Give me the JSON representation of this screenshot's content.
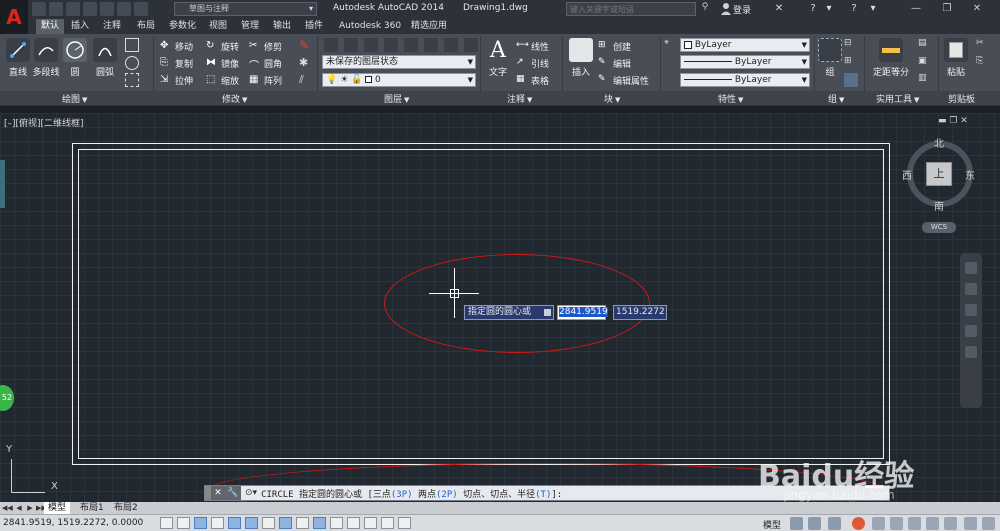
{
  "titlebar": {
    "workspace": "草图与注释",
    "app_title": "Autodesk AutoCAD 2014",
    "doc_title": "Drawing1.dwg",
    "search_placeholder": "键入关键字或短语",
    "login": "登录",
    "app_letter": "A"
  },
  "ribbon_tabs": [
    "默认",
    "插入",
    "注释",
    "布局",
    "参数化",
    "视图",
    "管理",
    "输出",
    "插件",
    "Autodesk 360",
    "精选应用"
  ],
  "active_tab": "默认",
  "ribbon": {
    "draw": {
      "title": "绘图",
      "line": "直线",
      "polyline": "多段线",
      "circle": "圆",
      "arc": "圆弧"
    },
    "modify": {
      "title": "修改",
      "move": "移动",
      "rotate": "旋转",
      "trim": "修剪",
      "copy": "复制",
      "mirror": "镜像",
      "fillet": "圆角",
      "stretch": "拉伸",
      "scale": "缩放",
      "array": "阵列"
    },
    "layers": {
      "title": "图层",
      "state": "未保存的图层状态",
      "current": "0"
    },
    "annotation": {
      "title": "注释",
      "text": "文字",
      "linear": "线性",
      "leader": "引线",
      "table": "表格"
    },
    "block": {
      "title": "块",
      "insert": "插入",
      "create": "创建",
      "edit": "编辑",
      "edit_attr": "编辑属性"
    },
    "properties": {
      "title": "特性",
      "color": "ByLayer",
      "linetype": "ByLayer",
      "lineweight": "ByLayer"
    },
    "groups": {
      "title": "组",
      "group": "组"
    },
    "utilities": {
      "title": "实用工具",
      "measure": "定距等分"
    },
    "clipboard": {
      "title": "剪贴板",
      "paste": "粘贴"
    }
  },
  "viewport": {
    "label": "[–][俯视][二维线框]",
    "prompt": "指定圆的圆心或",
    "coord_x": "2841.9519",
    "coord_y": "1519.2272"
  },
  "viewcube": {
    "north": "北",
    "south": "南",
    "east": "东",
    "west": "西",
    "face": "上",
    "wcs": "WCS"
  },
  "ucs": {
    "x": "X",
    "y": "Y"
  },
  "badge": "52",
  "command": {
    "name": "CIRCLE",
    "prompt": "指定圆的圆心或",
    "open": "[",
    "opt1_label": "三点",
    "opt1_key": "(3P)",
    "opt2_label": "两点",
    "opt2_key": "(2P)",
    "opt3_label": "切点、切点、半径",
    "opt3_key": "(T)",
    "close": "]:"
  },
  "layout_tabs": [
    "模型",
    "布局1",
    "布局2"
  ],
  "status": {
    "coords": "2841.9519, 1519.2272, 0.0000",
    "model": "模型"
  },
  "watermark": {
    "text": "Baidu经验",
    "url": "jingyan.baidu.com"
  },
  "colors": {
    "ribbon": "#494e56",
    "canvas": "#212830",
    "annotation_ellipse": "#d01818",
    "accent_blue": "#1e58c8"
  }
}
